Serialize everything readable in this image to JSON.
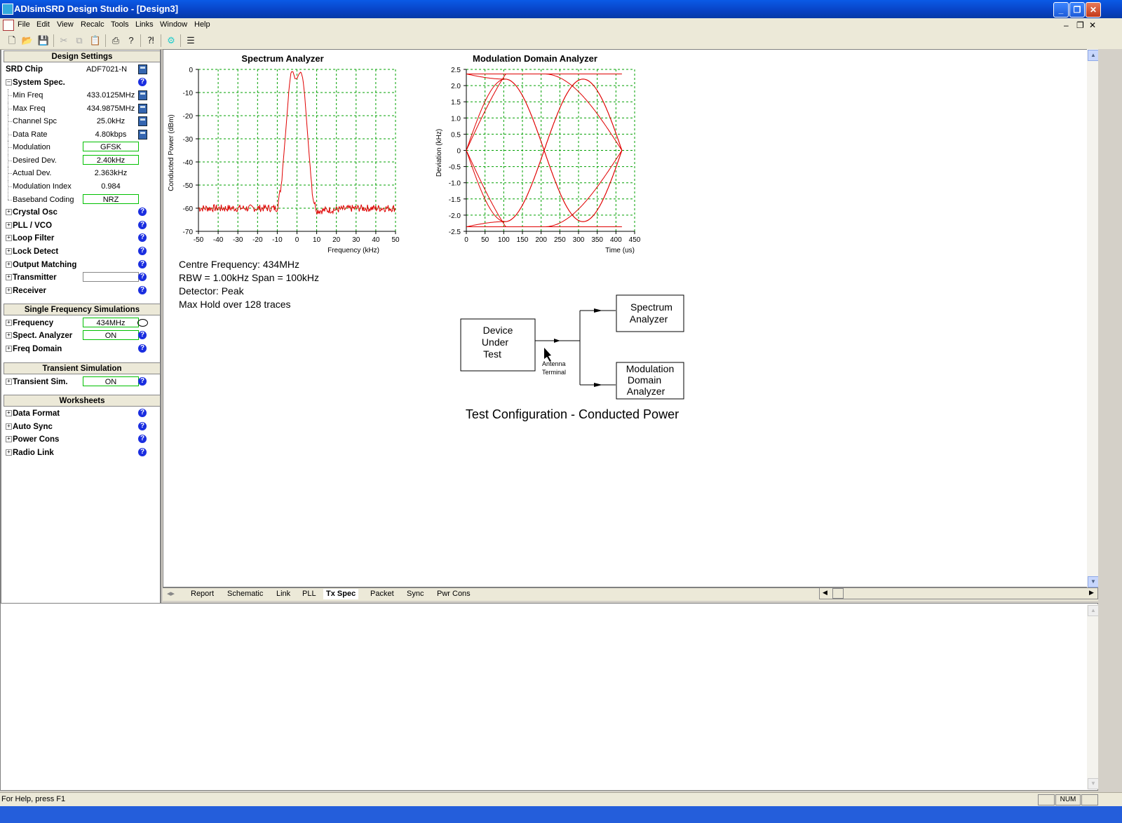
{
  "window": {
    "title": "ADIsimSRD Design Studio - [Design3]"
  },
  "menu": [
    "File",
    "Edit",
    "View",
    "Recalc",
    "Tools",
    "Links",
    "Window",
    "Help"
  ],
  "left": {
    "design_settings_header": "Design Settings",
    "srd_chip_label": "SRD Chip",
    "srd_chip_value": "ADF7021-N",
    "system_spec": "System Spec.",
    "rows": [
      {
        "label": "Min Freq",
        "value": "433.0125MHz"
      },
      {
        "label": "Max Freq",
        "value": "434.9875MHz"
      },
      {
        "label": "Channel Spc",
        "value": "25.0kHz"
      },
      {
        "label": "Data Rate",
        "value": "4.80kbps"
      },
      {
        "label": "Modulation",
        "value": "GFSK"
      },
      {
        "label": "Desired Dev.",
        "value": "2.40kHz"
      },
      {
        "label": "Actual Dev.",
        "value": "2.363kHz"
      },
      {
        "label": "Modulation Index",
        "value": "0.984"
      },
      {
        "label": "Baseband Coding",
        "value": "NRZ"
      }
    ],
    "groups": [
      "Crystal Osc",
      "PLL / VCO",
      "Loop Filter",
      "Lock Detect",
      "Output Matching",
      "Transmitter",
      "Receiver"
    ],
    "single_freq_header": "Single Frequency Simulations",
    "single_freq": [
      {
        "label": "Frequency",
        "value": "434MHz"
      },
      {
        "label": "Spect. Analyzer",
        "value": "ON"
      },
      {
        "label": "Freq Domain",
        "value": ""
      }
    ],
    "transient_header": "Transient Simulation",
    "transient": [
      {
        "label": "Transient Sim.",
        "value": "ON"
      }
    ],
    "worksheets_header": "Worksheets",
    "worksheets": [
      "Data Format",
      "Auto Sync",
      "Power Cons",
      "Radio Link"
    ]
  },
  "spectrum": {
    "title": "Spectrum Analyzer",
    "xlabel": "Frequency (kHz)",
    "ylabel": "Conducted Power (dBm)",
    "xticks": [
      "-50",
      "-40",
      "-30",
      "-20",
      "-10",
      "0",
      "10",
      "20",
      "30",
      "40",
      "50"
    ],
    "yticks": [
      "0",
      "-10",
      "-20",
      "-30",
      "-40",
      "-50",
      "-60",
      "-70"
    ],
    "info": [
      "Centre Frequency:  434MHz",
      "RBW = 1.00kHz    Span =  100kHz",
      "Detector: Peak",
      "Max Hold over 128 traces"
    ]
  },
  "modulation": {
    "title": "Modulation Domain Analyzer",
    "xlabel": "Time (us)",
    "ylabel": "Deviation (kHz)",
    "xticks": [
      "0",
      "50",
      "100",
      "150",
      "200",
      "250",
      "300",
      "350",
      "400",
      "450"
    ],
    "yticks": [
      "2.5",
      "2.0",
      "1.5",
      "1.0",
      "0.5",
      "0",
      "-0.5",
      "-1.0",
      "-1.5",
      "-2.0",
      "-2.5"
    ]
  },
  "diagram": {
    "dut": [
      "Device",
      "Under",
      "Test"
    ],
    "spectrum": [
      "Spectrum",
      "Analyzer"
    ],
    "mda": [
      "Modulation",
      "Domain",
      "Analyzer"
    ],
    "antenna": [
      "Antenna",
      "Terminal"
    ],
    "caption": "Test Configuration - Conducted Power"
  },
  "chart_data": [
    {
      "type": "line",
      "title": "Spectrum Analyzer",
      "xlabel": "Frequency (kHz)",
      "ylabel": "Conducted Power (dBm)",
      "xlim": [
        -50,
        50
      ],
      "ylim": [
        -70,
        0
      ],
      "grid": true,
      "series": [
        {
          "x": [
            -50,
            -30,
            -10,
            -8,
            -6,
            -4,
            -3,
            -2,
            -1,
            0,
            1,
            2,
            3,
            4,
            6,
            8,
            10,
            12,
            30,
            50
          ],
          "y": [
            -60,
            -60,
            -60,
            -50,
            -30,
            -8,
            -1,
            -1,
            -4,
            -4,
            -2,
            -1,
            -4,
            -12,
            -35,
            -55,
            -61,
            -61,
            -60,
            -60
          ]
        }
      ]
    },
    {
      "type": "line",
      "title": "Modulation Domain Analyzer",
      "xlabel": "Time (us)",
      "ylabel": "Deviation (kHz)",
      "xlim": [
        0,
        450
      ],
      "ylim": [
        -2.5,
        2.5
      ],
      "grid": true,
      "series": [
        {
          "x": [
            0,
            104,
            208,
            312,
            416
          ],
          "y": [
            0,
            2.2,
            0,
            -2.2,
            0
          ]
        },
        {
          "x": [
            0,
            104,
            208,
            312,
            416
          ],
          "y": [
            0,
            -2.2,
            0,
            2.2,
            0
          ]
        },
        {
          "x": [
            0,
            416
          ],
          "y": [
            2.36,
            2.36
          ]
        },
        {
          "x": [
            0,
            416
          ],
          "y": [
            -2.36,
            -2.36
          ]
        }
      ]
    }
  ],
  "tabs": [
    "Report",
    "Schematic",
    "Link",
    "PLL",
    "Tx Spec",
    "Packet",
    "Sync",
    "Pwr Cons"
  ],
  "status": {
    "help": "For Help, press F1",
    "num": "NUM"
  }
}
